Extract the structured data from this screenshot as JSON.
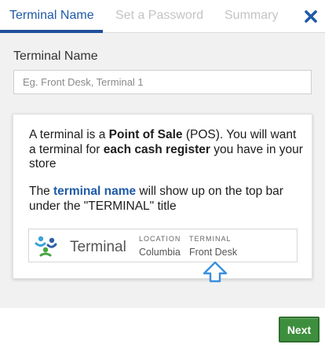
{
  "tabs": [
    {
      "label": "Terminal Name",
      "active": true
    },
    {
      "label": "Set a Password",
      "active": false
    },
    {
      "label": "Summary",
      "active": false
    }
  ],
  "close_icon": "close-x-icon",
  "form": {
    "label": "Terminal Name",
    "value": "",
    "placeholder": "Eg. Front Desk, Terminal 1"
  },
  "info": {
    "p1": {
      "t1": "A terminal is a ",
      "b1": "Point of Sale",
      "t2": " (POS). You will want a terminal for ",
      "b2": "each cash register",
      "t3": " you have in your store"
    },
    "p2": {
      "t1": "The ",
      "hl": "terminal name",
      "t2": " will show up on the top bar under the \"TERMINAL\" title"
    }
  },
  "preview": {
    "logo_icon": "brand-logo-icon",
    "title": "Terminal",
    "location_label": "LOCATION",
    "location_value": "Columbia",
    "terminal_label": "TERMINAL",
    "terminal_value": "Front Desk",
    "pointer_icon": "up-arrow-icon"
  },
  "footer": {
    "next_label": "Next"
  },
  "colors": {
    "accent": "#1f5aa6",
    "next_button": "#3d8f3d",
    "inactive_tab": "#c4c4c4"
  }
}
